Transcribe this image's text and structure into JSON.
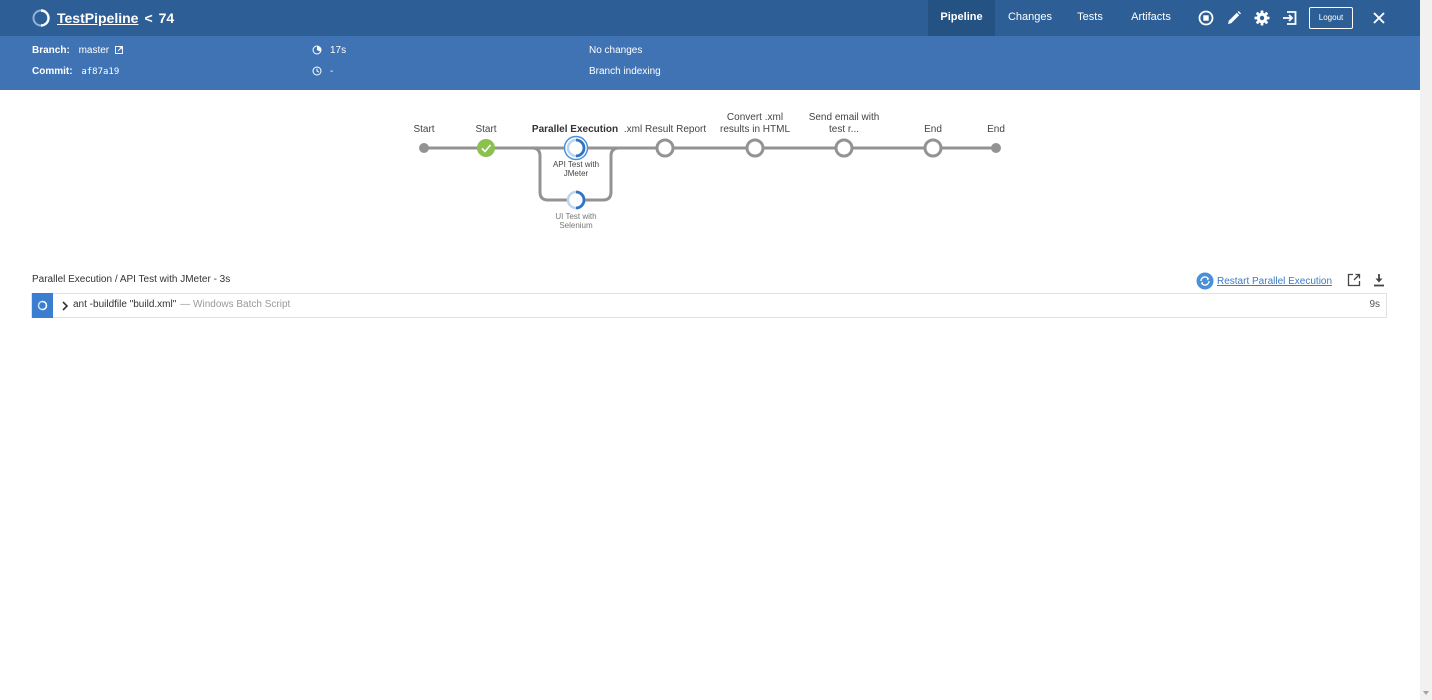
{
  "header": {
    "pipeline_name": "TestPipeline",
    "separator": "<",
    "run_number": "74",
    "tabs": [
      {
        "label": "Pipeline",
        "active": true
      },
      {
        "label": "Changes",
        "active": false
      },
      {
        "label": "Tests",
        "active": false
      },
      {
        "label": "Artifacts",
        "active": false
      }
    ],
    "logout_label": "Logout",
    "icons": [
      "stop-icon",
      "edit-icon",
      "gear-icon",
      "exit-icon",
      "close-icon"
    ]
  },
  "info": {
    "branch_label": "Branch:",
    "branch_value": "master",
    "commit_label": "Commit:",
    "commit_value": "af87a19",
    "duration": "17s",
    "time_ago": "-",
    "changes": "No changes",
    "cause": "Branch indexing"
  },
  "graph": {
    "stages": [
      {
        "label": "Start",
        "state": "start"
      },
      {
        "label": "Start",
        "state": "success"
      },
      {
        "label": "Parallel Execution",
        "state": "running",
        "selected": true
      },
      {
        "label": ".xml Result Report",
        "state": "queued"
      },
      {
        "label": "Convert .xml results in HTML",
        "label_line1": "Convert .xml",
        "label_line2": "results in HTML",
        "state": "queued"
      },
      {
        "label": "Send email with test r...",
        "label_line1": "Send email with",
        "label_line2": "test r...",
        "state": "queued"
      },
      {
        "label": "End",
        "state": "queued"
      },
      {
        "label": "End",
        "state": "end"
      }
    ],
    "branches": [
      {
        "line1": "API Test with",
        "line2": "JMeter",
        "state": "running"
      },
      {
        "line1": "UI Test with",
        "line2": "Selenium",
        "state": "running"
      }
    ]
  },
  "log": {
    "title": "Parallel Execution / API Test with JMeter - 3s",
    "restart_label": "Restart Parallel Execution",
    "steps": [
      {
        "command": "ant -buildfile \"build.xml\"",
        "description": "— Windows Batch Script",
        "duration": "9s",
        "state": "running"
      }
    ]
  },
  "colors": {
    "header_bg": "#2d5f96",
    "infobar_bg": "#3f73b4",
    "success": "#8cc04f",
    "running": "#4a90d9",
    "link": "#3e7bc4"
  }
}
